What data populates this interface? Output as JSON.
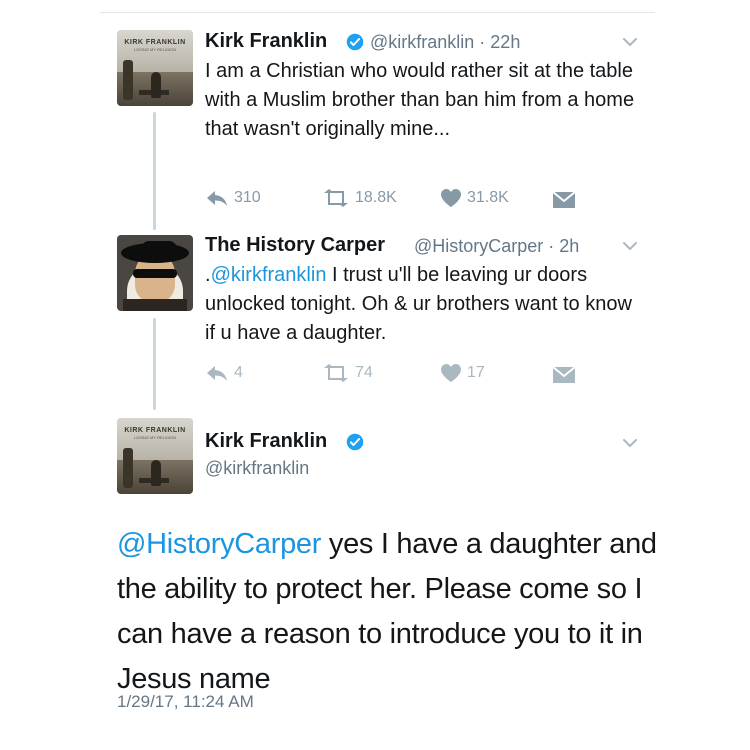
{
  "tweet1": {
    "name": "Kirk Franklin",
    "handle": "@kirkfranklin",
    "time": "22h",
    "text": "I am a Christian who would rather sit at the table with a Muslim brother than ban him from a home that wasn't originally mine...",
    "actions": {
      "replies": "310",
      "retweets": "18.8K",
      "likes": "31.8K"
    }
  },
  "tweet2": {
    "name": "The History Carper",
    "handle": "@HistoryCarper",
    "time": "2h",
    "text_prefix": ".",
    "mention": "@kirkfranklin",
    "text": " I trust u'll be leaving ur doors unlocked tonight. Oh & ur brothers want to know if u have a daughter.",
    "actions": {
      "replies": "4",
      "retweets": "74",
      "likes": "17"
    }
  },
  "tweet3": {
    "name": "Kirk Franklin",
    "handle": "@kirkfranklin",
    "mention": "@HistoryCarper",
    "text": " yes I have a daughter and the ability to protect her. Please come so I can have a reason to introduce you to it in Jesus name",
    "timestamp": "1/29/17, 11:24 AM"
  },
  "avatar_text": {
    "title": "KIRK FRANKLIN",
    "subtitle": "LOSING MY RELIGION"
  },
  "colors": {
    "link": "#1b95e0",
    "secondary": "#657786",
    "icon": "#8899a6",
    "verified": "#1da1f2",
    "thread_line": "#ccd6dd"
  },
  "icons": [
    "verified-badge-icon",
    "chevron-down-icon",
    "reply-icon",
    "retweet-icon",
    "heart-icon",
    "envelope-icon"
  ]
}
